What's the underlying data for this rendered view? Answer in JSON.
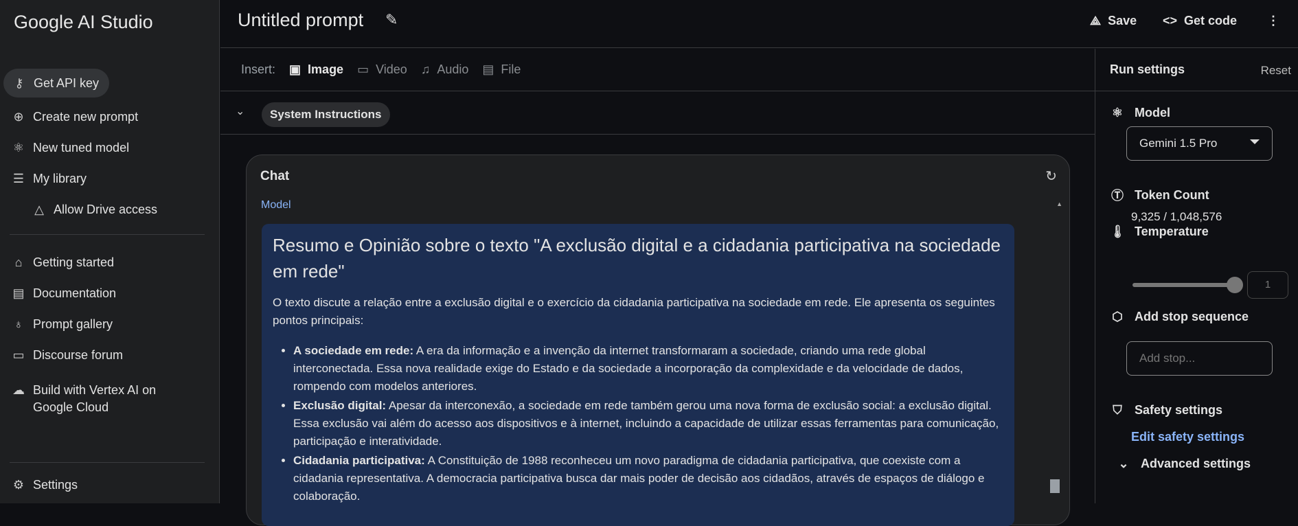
{
  "sidebar": {
    "logo": "Google AI Studio",
    "items": [
      {
        "label": "Get API key",
        "icon": "key-icon"
      },
      {
        "label": "Create new prompt",
        "icon": "plus-circle-icon"
      },
      {
        "label": "New tuned model",
        "icon": "atom-icon"
      },
      {
        "label": "My library",
        "icon": "library-icon"
      },
      {
        "label": "Allow Drive access",
        "icon": "drive-add-icon"
      },
      {
        "label": "Getting started",
        "icon": "school-icon"
      },
      {
        "label": "Documentation",
        "icon": "doc-search-icon"
      },
      {
        "label": "Prompt gallery",
        "icon": "lightbulb-icon"
      },
      {
        "label": "Discourse forum",
        "icon": "forum-icon"
      },
      {
        "label": "Build with Vertex AI on",
        "label2": "Google Cloud",
        "icon": "cloud-icon"
      },
      {
        "label": "Settings",
        "icon": "gear-icon"
      }
    ]
  },
  "header": {
    "title": "Untitled prompt",
    "save": "Save",
    "get_code": "Get code"
  },
  "insert": {
    "label": "Insert:",
    "items": [
      "Image",
      "Video",
      "Audio",
      "File"
    ]
  },
  "system_instructions": "System Instructions",
  "chat": {
    "title": "Chat",
    "role": "Model",
    "heading": "Resumo e Opinião sobre o texto \"A exclusão digital e a cidadania participativa na sociedade em rede\"",
    "intro": "O texto discute a relação entre a exclusão digital e o exercício da cidadania participativa na sociedade em rede. Ele apresenta os seguintes pontos principais:",
    "bullets": [
      {
        "bold": "A sociedade em rede:",
        "text": " A era da informação e a invenção da internet transformaram a sociedade, criando uma rede global interconectada. Essa nova realidade exige do Estado e da sociedade a incorporação da complexidade e da velocidade de dados, rompendo com modelos anteriores."
      },
      {
        "bold": "Exclusão digital:",
        "text": " Apesar da interconexão, a sociedade em rede também gerou uma nova forma de exclusão social: a exclusão digital. Essa exclusão vai além do acesso aos dispositivos e à internet, incluindo a capacidade de utilizar essas ferramentas para comunicação, participação e interatividade."
      },
      {
        "bold": "Cidadania participativa:",
        "text": " A Constituição de 1988 reconheceu um novo paradigma de cidadania participativa, que coexiste com a cidadania representativa. A democracia participativa busca dar mais poder de decisão aos cidadãos, através de espaços de diálogo e colaboração."
      }
    ]
  },
  "run_settings": {
    "title": "Run settings",
    "reset": "Reset",
    "model_label": "Model",
    "model_value": "Gemini 1.5 Pro",
    "token_label": "Token Count",
    "token_value": "9,325 / 1,048,576",
    "temperature_label": "Temperature",
    "temperature_value": "1",
    "temperature_fraction": 1.0,
    "stop_label": "Add stop sequence",
    "stop_placeholder": "Add stop...",
    "safety_label": "Safety settings",
    "safety_link": "Edit safety settings",
    "advanced": "Advanced settings"
  },
  "colors": {
    "accent": "#8ab4f8",
    "response_bg": "#1c2e52"
  }
}
